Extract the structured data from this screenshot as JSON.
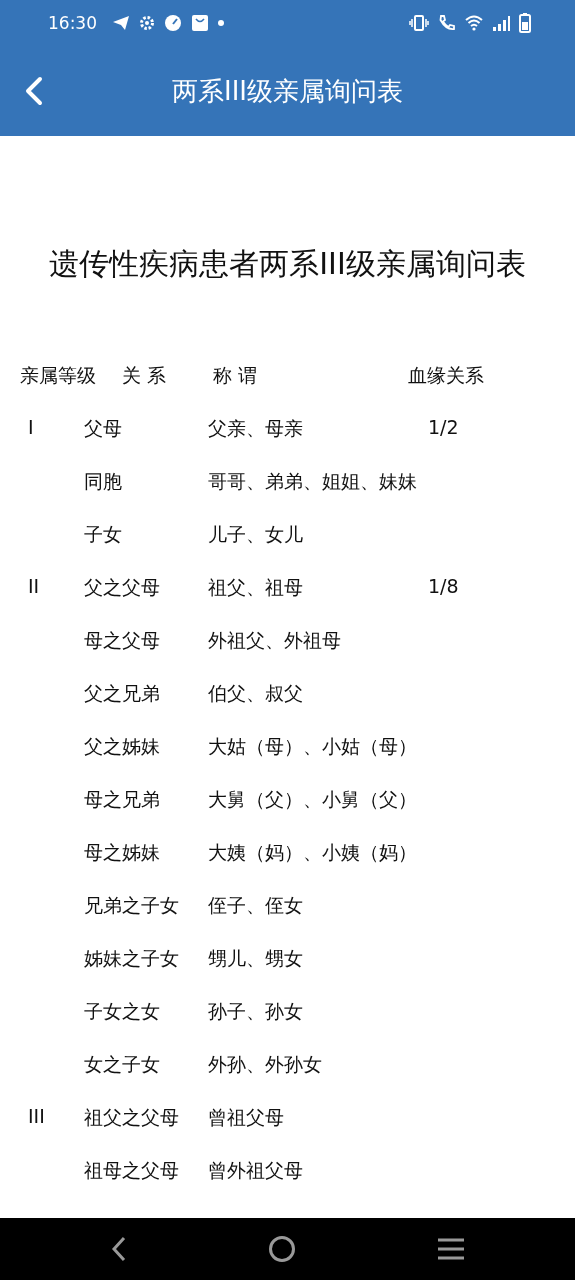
{
  "status_bar": {
    "time": "16:30"
  },
  "app_bar": {
    "title": "两系III级亲属询问表"
  },
  "document": {
    "heading": "遗传性疾病患者两系III级亲属询问表",
    "columns": [
      "亲属等级",
      "关 系",
      "称 谓",
      "血缘关系"
    ],
    "rows": [
      {
        "level": "I",
        "relation": "父母",
        "titles": "父亲、母亲",
        "kinship": "1/2"
      },
      {
        "relation": "同胞",
        "titles": "哥哥、弟弟、姐姐、妹妹"
      },
      {
        "relation": "子女",
        "titles": "儿子、女儿"
      },
      {
        "level": "II",
        "relation": "父之父母",
        "titles": "祖父、祖母",
        "kinship": "1/8"
      },
      {
        "relation": "母之父母",
        "titles": "外祖父、外祖母"
      },
      {
        "relation": "父之兄弟",
        "titles": "伯父、叔父"
      },
      {
        "relation": "父之姊妹",
        "titles": "大姑（母）、小姑（母）"
      },
      {
        "relation": "母之兄弟",
        "titles": "大舅（父）、小舅（父）"
      },
      {
        "relation": "母之姊妹",
        "titles": "大姨（妈）、小姨（妈）"
      },
      {
        "relation": "兄弟之子女",
        "titles": "侄子、侄女"
      },
      {
        "relation": "姊妹之子女",
        "titles": "甥儿、甥女"
      },
      {
        "relation": "子女之女",
        "titles": "孙子、孙女"
      },
      {
        "relation": "女之子女",
        "titles": "外孙、外孙女"
      },
      {
        "level": "III",
        "relation": "祖父之父母",
        "titles": "曾祖父母"
      },
      {
        "relation": "祖母之父母",
        "titles": "曾外祖父母"
      }
    ]
  }
}
